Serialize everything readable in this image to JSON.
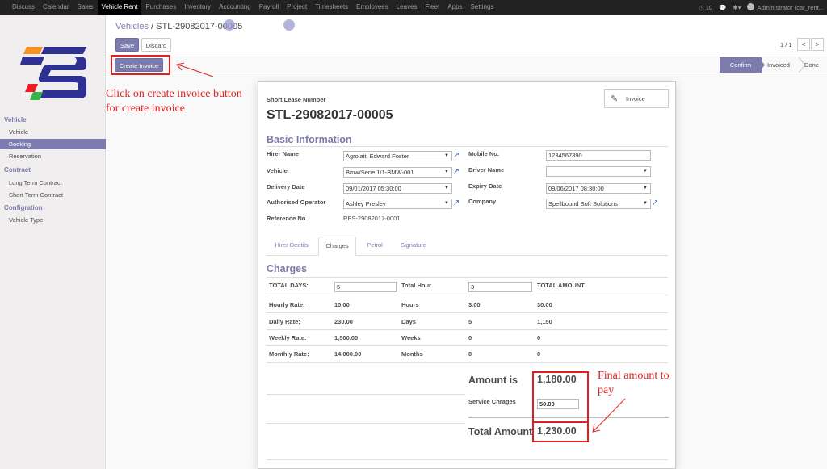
{
  "topnav": {
    "menus": [
      "Discuss",
      "Calendar",
      "Sales",
      "Vehicle Rent",
      "Purchases",
      "Inventory",
      "Accounting",
      "Payroll",
      "Project",
      "Timesheets",
      "Employees",
      "Leaves",
      "Fleet",
      "Apps",
      "Settings"
    ],
    "active_menu": "Vehicle Rent",
    "notifications": "10",
    "user": "Administrator (car_rent..."
  },
  "sidebar": {
    "sections": [
      {
        "title": "Vehicle",
        "items": [
          "Vehicle",
          "Booking",
          "Reservation"
        ]
      },
      {
        "title": "Contract",
        "items": [
          "Long Term Contract",
          "Short Term Contract"
        ]
      },
      {
        "title": "Configration",
        "items": [
          "Vehicle Type"
        ]
      }
    ],
    "active_item": "Booking",
    "logo_colors": {
      "orange": "#f7931e",
      "blue": "#2e3192",
      "red": "#ed1c24",
      "green": "#39b54a"
    }
  },
  "breadcrumb": {
    "parent": "Vehicles",
    "separator": "/",
    "current": "STL-29082017-00005"
  },
  "buttons": {
    "save": "Save",
    "discard": "Discard",
    "create_invoice": "Create Invoice"
  },
  "pager": {
    "value": "1 / 1",
    "prev": "<",
    "next": ">"
  },
  "statusbar": {
    "stages": [
      "Confirm",
      "Invoiced",
      "Done"
    ],
    "current": "Confirm"
  },
  "smart_button": {
    "label": "Invoice"
  },
  "form": {
    "number_label": "Short Lease Number",
    "number": "STL-29082017-00005",
    "basic_info_title": "Basic Information",
    "left": [
      {
        "label": "Hirer Name",
        "value": "Agrolait, Edward Foster"
      },
      {
        "label": "Vehicle",
        "value": "Bmw/Serie 1/1-BMW-001"
      },
      {
        "label": "Delivery Date",
        "value": "09/01/2017 05:30:00"
      },
      {
        "label": "Authorised Operator",
        "value": "Ashley Presley"
      },
      {
        "label": "Reference No",
        "value": "RES-29082017-0001"
      }
    ],
    "right": [
      {
        "label": "Mobile No.",
        "value": "1234567890"
      },
      {
        "label": "Driver Name",
        "value": ""
      },
      {
        "label": "Expiry Date",
        "value": "09/06/2017 08:30:00"
      },
      {
        "label": "Company",
        "value": "Spellbound Soft Solutions"
      }
    ],
    "tabs": [
      "Hirer Deatils",
      "Charges",
      "Petrol",
      "Signature"
    ],
    "active_tab": "Charges"
  },
  "charges": {
    "title": "Charges",
    "total_days_label": "TOTAL DAYS:",
    "total_days": "5",
    "total_hour_label": "Total Hour",
    "total_hour": "3",
    "total_amount_label": "TOTAL AMOUNT",
    "rows": [
      {
        "label": "Hourly Rate:",
        "rate": "10.00",
        "unit": "Hours",
        "qty": "3.00",
        "amount": "30.00"
      },
      {
        "label": "Daily Rate:",
        "rate": "230.00",
        "unit": "Days",
        "qty": "5",
        "amount": "1,150"
      },
      {
        "label": "Weekly Rate:",
        "rate": "1,500.00",
        "unit": "Weeks",
        "qty": "0",
        "amount": "0"
      },
      {
        "label": "Monthly Rate:",
        "rate": "14,000.00",
        "unit": "Months",
        "qty": "0",
        "amount": "0"
      }
    ],
    "amount_is_label": "Amount is",
    "amount_is": "1,180.00",
    "service_label": "Service Chrages",
    "service": "50.00",
    "total_label": "Total Amount",
    "total": "1,230.00"
  },
  "annotations": {
    "create_invoice_line1": "Click on create invoice button",
    "create_invoice_line2": "for create invoice",
    "final_line1": "Final amount to",
    "final_line2": "pay",
    "color": "#e02020"
  }
}
